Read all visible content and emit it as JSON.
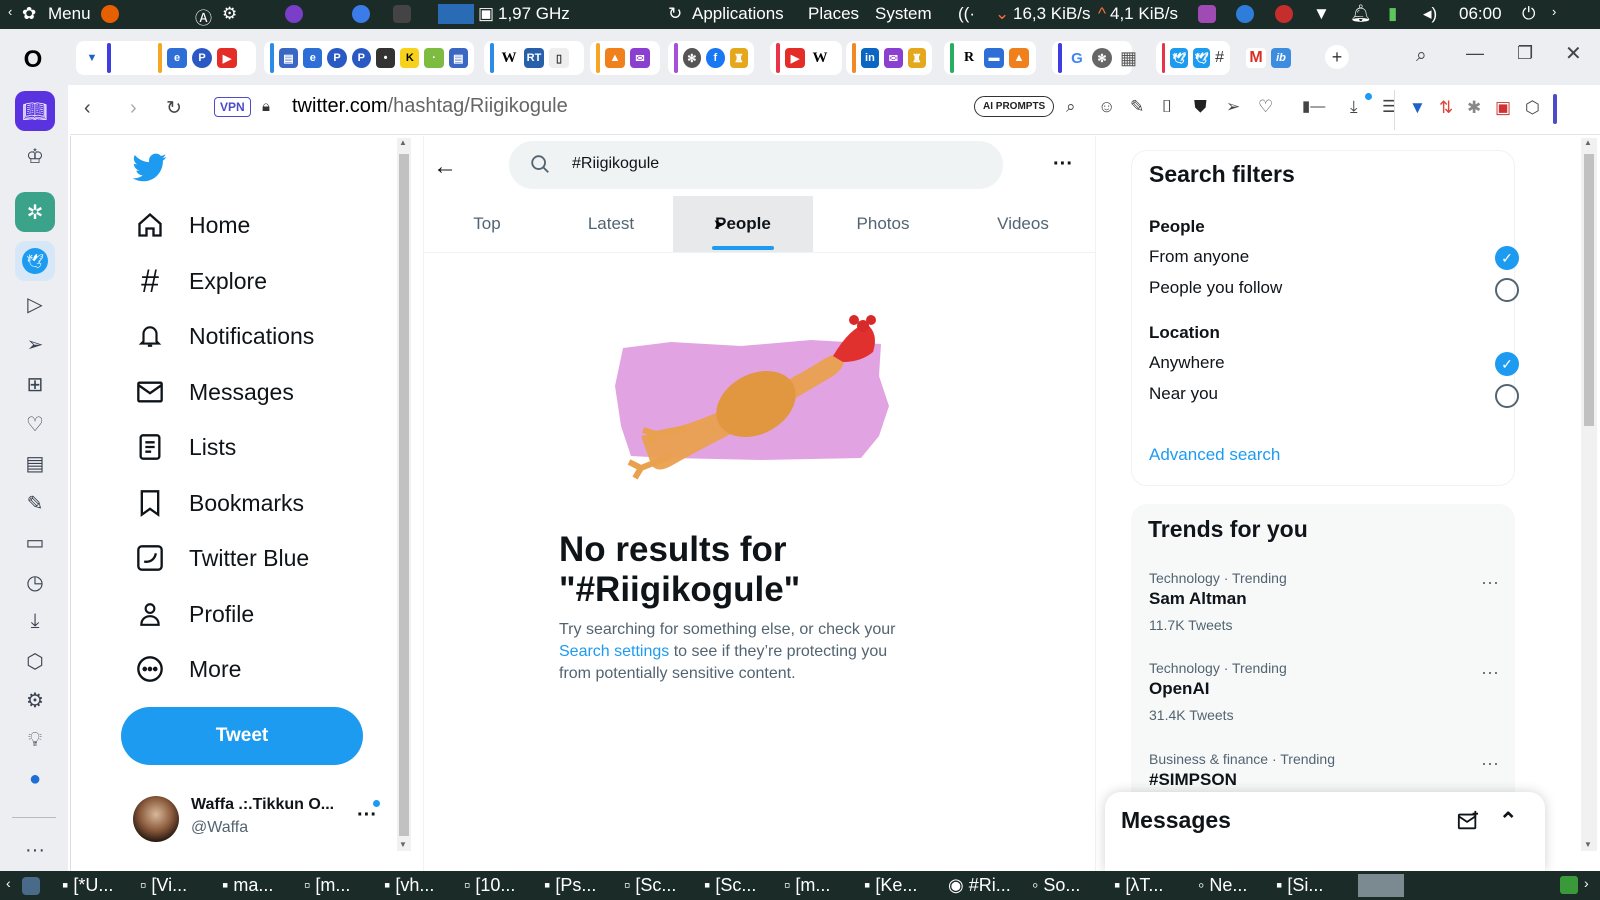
{
  "system_bar": {
    "menu": "Menu",
    "cpu_freq": "1,97 GHz",
    "applications": "Applications",
    "places": "Places",
    "system": "System",
    "net_down": "16,3 KiB/s",
    "net_up": "4,1 KiB/s",
    "clock": "06:00"
  },
  "browser": {
    "vpn": "VPN",
    "url_host": "twitter.com",
    "url_path": "/hashtag/Riigikogule",
    "ai_prompts": "AI PROMPTS",
    "tab_favicons_group1": [
      "W",
      "RT"
    ],
    "tab_favicons_group2": [
      "K"
    ],
    "tab_favicons_group3": [
      "R",
      "G"
    ]
  },
  "twitter": {
    "nav": [
      {
        "label": "Home",
        "icon": "home-icon"
      },
      {
        "label": "Explore",
        "icon": "hashtag-icon"
      },
      {
        "label": "Notifications",
        "icon": "bell-icon"
      },
      {
        "label": "Messages",
        "icon": "envelope-icon"
      },
      {
        "label": "Lists",
        "icon": "list-icon"
      },
      {
        "label": "Bookmarks",
        "icon": "bookmark-icon"
      },
      {
        "label": "Twitter Blue",
        "icon": "twitter-blue-icon"
      },
      {
        "label": "Profile",
        "icon": "person-icon"
      },
      {
        "label": "More",
        "icon": "more-circle-icon"
      }
    ],
    "tweet_button": "Tweet",
    "account": {
      "name": "Waffa .:.Tikkun O...",
      "handle": "@Waffa"
    },
    "search_value": "#Riigikogule",
    "tabs": [
      "Top",
      "Latest",
      "People",
      "Photos",
      "Videos"
    ],
    "active_tab": "People",
    "empty": {
      "title_line1": "No results for",
      "title_line2": "\"#Riigikogule\"",
      "desc_before": "Try searching for something else, or check your",
      "desc_link": "Search settings",
      "desc_after": " to see if they’re protecting you",
      "desc_line3": "from potentially sensitive content."
    },
    "filters": {
      "title": "Search filters",
      "people_heading": "People",
      "from_anyone": "From anyone",
      "people_you_follow": "People you follow",
      "location_heading": "Location",
      "anywhere": "Anywhere",
      "near_you": "Near you",
      "advanced": "Advanced search"
    },
    "trends": {
      "title": "Trends for you",
      "items": [
        {
          "meta": "Technology · Trending",
          "name": "Sam Altman",
          "count": "11.7K Tweets"
        },
        {
          "meta": "Technology · Trending",
          "name": "OpenAI",
          "count": "31.4K Tweets"
        },
        {
          "meta": "Business & finance · Trending",
          "name": "#SIMPSON",
          "count": ""
        }
      ]
    },
    "messages_drawer": "Messages"
  },
  "taskbar": {
    "items": [
      "[*U...",
      "[Vi...",
      "ma...",
      "[m...",
      "[vh...",
      "[10...",
      "[Ps...",
      "[Sc...",
      "[Sc...",
      "[m...",
      "[Ke...",
      "#Ri...",
      "So...",
      "[λT...",
      "Ne...",
      "[Si..."
    ]
  },
  "colors": {
    "twitter_blue": "#1d9bf0",
    "system_bar": "#1b2b27",
    "chicken_bg": "#e2a3e2"
  }
}
